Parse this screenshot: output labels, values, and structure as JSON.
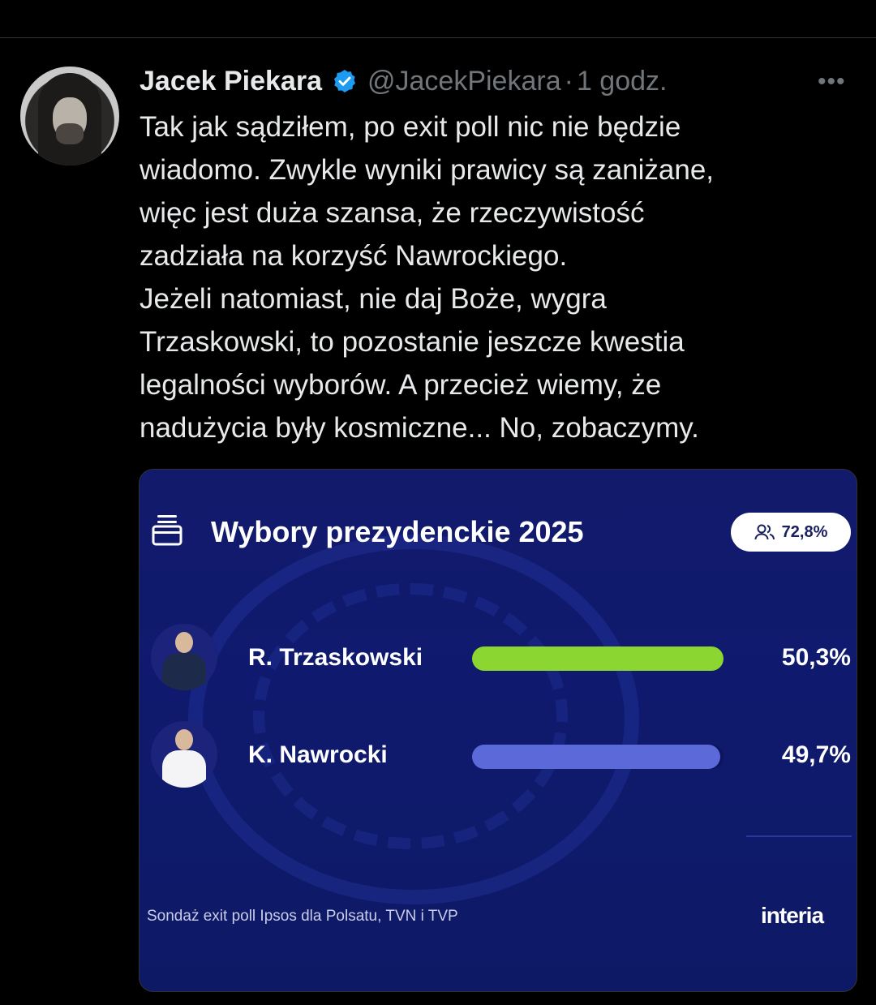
{
  "tweet": {
    "author_name": "Jacek Piekara",
    "handle": "@JacekPiekara",
    "separator": "·",
    "time": "1 godz.",
    "more_label": "•••",
    "text_lines": [
      "Tak jak sądziłem, po exit poll nic nie będzie",
      "wiadomo. Zwykle wyniki prawicy są zaniżane,",
      "więc jest duża szansa, że rzeczywistość",
      "zadziała na korzyść Nawrockiego.",
      "Jeżeli natomiast, nie daj Boże, wygra",
      "Trzaskowski, to pozostanie jeszcze kwestia",
      "legalności wyborów. A przecież wiemy, że",
      "nadużycia były kosmiczne... No, zobaczymy."
    ]
  },
  "card": {
    "title": "Wybory prezydenckie 2025",
    "turnout": "72,8%",
    "source": "Sondaż exit poll Ipsos dla Polsatu, TVN i TVP",
    "brand": "interia",
    "candidates": [
      {
        "name": "R. Trzaskowski",
        "percent_label": "50,3%",
        "value": 50.3,
        "color": "#8bd630"
      },
      {
        "name": "K. Nawrocki",
        "percent_label": "49,7%",
        "value": 49.7,
        "color": "#5b6ad8"
      }
    ]
  },
  "colors": {
    "background": "#000000",
    "accent_verified": "#1d9bf0",
    "muted": "#71767b",
    "card_bg": "#121a6b"
  }
}
